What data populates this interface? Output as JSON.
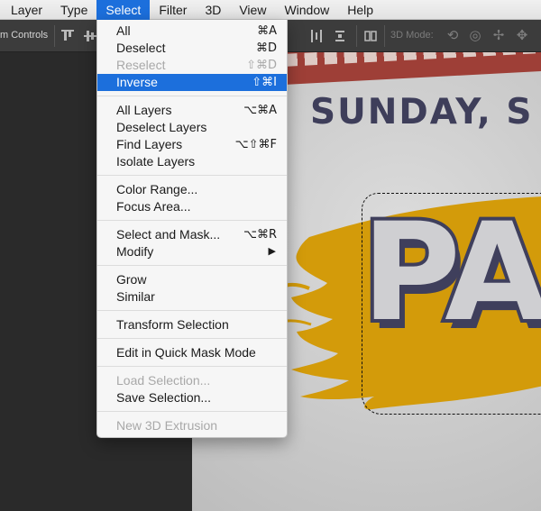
{
  "menubar": {
    "items": [
      "Layer",
      "Type",
      "Select",
      "Filter",
      "3D",
      "View",
      "Window",
      "Help"
    ],
    "active": "Select"
  },
  "options_bar": {
    "transform_controls_label": "m Controls",
    "mode_3d_label": "3D Mode:",
    "icons_3d": [
      "rotate-3d-icon",
      "roll-3d-icon",
      "drag-3d-icon",
      "slide-3d-icon",
      "scale-3d-icon"
    ]
  },
  "select_menu": {
    "all": {
      "label": "All",
      "shortcut": "⌘A"
    },
    "deselect": {
      "label": "Deselect",
      "shortcut": "⌘D"
    },
    "reselect": {
      "label": "Reselect",
      "shortcut": "⇧⌘D"
    },
    "inverse": {
      "label": "Inverse",
      "shortcut": "⇧⌘I"
    },
    "all_layers": {
      "label": "All Layers",
      "shortcut": "⌥⌘A"
    },
    "deselect_layers": {
      "label": "Deselect Layers"
    },
    "find_layers": {
      "label": "Find Layers",
      "shortcut": "⌥⇧⌘F"
    },
    "isolate_layers": {
      "label": "Isolate Layers"
    },
    "color_range": {
      "label": "Color Range..."
    },
    "focus_area": {
      "label": "Focus Area..."
    },
    "select_and_mask": {
      "label": "Select and Mask...",
      "shortcut": "⌥⌘R"
    },
    "modify": {
      "label": "Modify",
      "submenu_arrow": "▶"
    },
    "grow": {
      "label": "Grow"
    },
    "similar": {
      "label": "Similar"
    },
    "transform_selection": {
      "label": "Transform Selection"
    },
    "quick_mask": {
      "label": "Edit in Quick Mask Mode"
    },
    "load_selection": {
      "label": "Load Selection..."
    },
    "save_selection": {
      "label": "Save Selection..."
    },
    "new_3d_extrusion": {
      "label": "New 3D Extrusion"
    }
  },
  "canvas": {
    "headline": "SUNDAY, S",
    "title_partial": "PA",
    "colors": {
      "brush_yellow": "#d39b0a",
      "banner_red": "#9e3f37",
      "text_navy": "#3e3e5a",
      "highlight": "#1c6fdc"
    }
  }
}
